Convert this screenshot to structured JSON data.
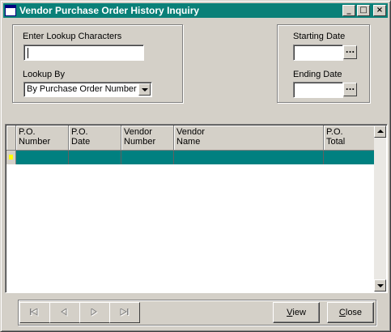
{
  "window": {
    "title": "Vendor Purchase Order History Inquiry",
    "controls": {
      "minimize": "_",
      "maximize": "□",
      "close": "×"
    }
  },
  "lookup": {
    "characters_label": "Enter Lookup Characters",
    "characters_value": "",
    "lookup_by_label": "Lookup By",
    "lookup_by_value": "By Purchase Order Number"
  },
  "dates": {
    "starting_label": "Starting Date",
    "starting_value": "",
    "ending_label": "Ending Date",
    "ending_value": "",
    "picker_glyph": "..."
  },
  "grid": {
    "columns": [
      "P.O.\nNumber",
      "P.O.\nDate",
      "Vendor\nNumber",
      "Vendor\nName",
      "P.O.\nTotal"
    ],
    "rows": [
      [
        "",
        "",
        "",
        "",
        ""
      ]
    ],
    "selected_row_color": "#008080"
  },
  "footer": {
    "view_label_first": "V",
    "view_label_rest": "iew",
    "close_label_first": "C",
    "close_label_rest": "lose"
  },
  "colors": {
    "titlebar": "#0a8078",
    "face": "#d4d0c8",
    "row_indicator": "#ffff00"
  }
}
